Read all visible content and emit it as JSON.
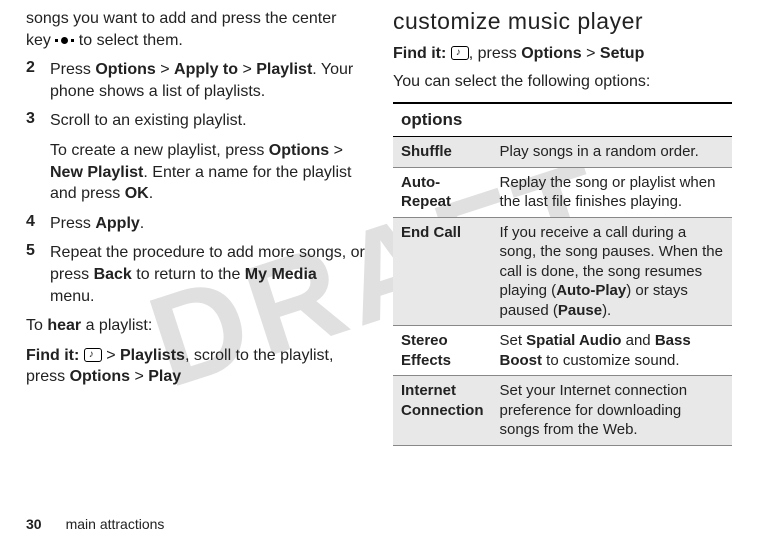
{
  "left": {
    "intro1": "songs you want to add and press the center key ",
    "intro2": " to select them.",
    "step2_a": "Press ",
    "step2_opt": "Options",
    "step2_gt1": " > ",
    "step2_apply": "Apply to",
    "step2_gt2": " > ",
    "step2_playlist": "Playlist",
    "step2_b": ". Your phone shows a list of playlists.",
    "step3": "Scroll to an existing playlist.",
    "step3_sub_a": "To create a new playlist, press ",
    "step3_sub_opt": "Options",
    "step3_sub_gt": " > ",
    "step3_sub_np": "New Playlist",
    "step3_sub_b": ". Enter a name for the playlist and press ",
    "step3_sub_ok": "OK",
    "step3_sub_c": ".",
    "step4_a": "Press ",
    "step4_apply": "Apply",
    "step4_b": ".",
    "step5_a": "Repeat the procedure to add more songs, or press ",
    "step5_back": "Back",
    "step5_b": " to return to the ",
    "step5_mm": "My Media",
    "step5_c": " menu.",
    "hear_a": "To ",
    "hear_b": "hear",
    "hear_c": " a playlist:",
    "findit_label": "Find it: ",
    "findit_gt1": " > ",
    "findit_playlists": "Playlists",
    "findit_mid": ", scroll to the playlist, press ",
    "findit_opt": "Options",
    "findit_gt2": " > ",
    "findit_play": "Play",
    "num2": "2",
    "num3": "3",
    "num4": "4",
    "num5": "5"
  },
  "right": {
    "title": "customize music player",
    "findit_label": "Find it: ",
    "findit_a": ", press ",
    "findit_opt": "Options",
    "findit_gt": " > ",
    "findit_setup": "Setup",
    "select_text": "You can select the following options:",
    "table_header": "options",
    "rows": [
      {
        "name": "Shuffle",
        "desc_a": "Play songs in a random order."
      },
      {
        "name": "Auto-Repeat",
        "desc_a": "Replay the song or playlist when the last file finishes playing."
      },
      {
        "name": "End Call",
        "desc_a": "If you receive a call during a song, the song pauses. When the call is done, the song resumes playing (",
        "desc_b": "Auto-Play",
        "desc_c": ") or stays paused (",
        "desc_d": "Pause",
        "desc_e": ")."
      },
      {
        "name": "Stereo Effects",
        "desc_a": "Set ",
        "desc_b": "Spatial Audio",
        "desc_c": " and ",
        "desc_d": "Bass Boost",
        "desc_e": " to customize sound."
      },
      {
        "name": "Internet Connection",
        "desc_a": "Set your Internet connection preference for downloading songs from the Web."
      }
    ]
  },
  "footer": {
    "page": "30",
    "section": "main attractions"
  },
  "watermark": "DRAFT"
}
